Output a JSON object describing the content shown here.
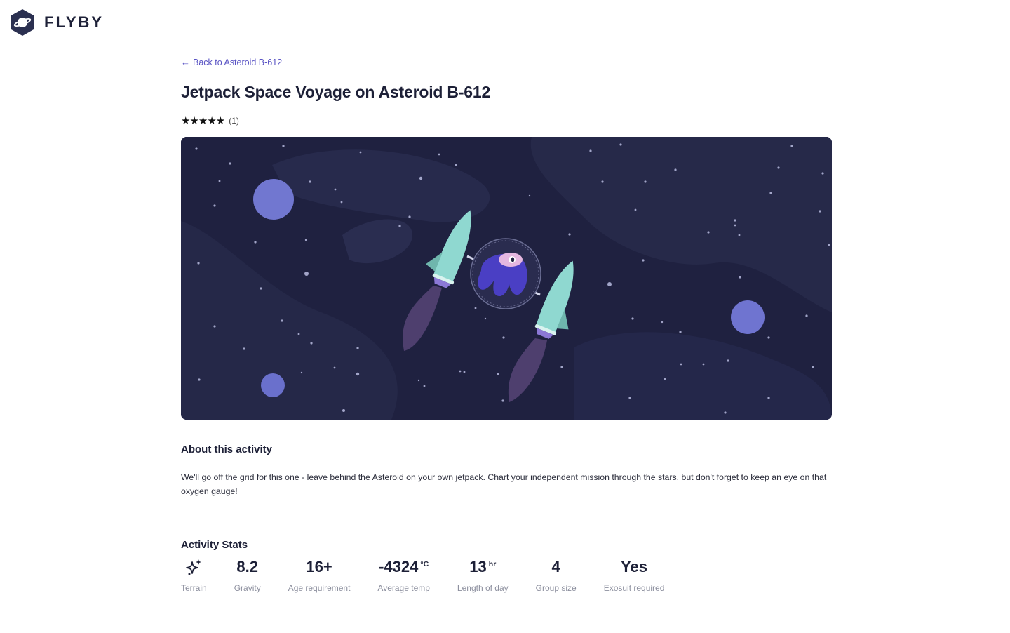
{
  "brand": {
    "name": "FLYBY",
    "logo_icon": "planet-hexagon-icon"
  },
  "nav": {
    "back_label": "Back to Asteroid B-612",
    "back_icon": "arrow-left-icon"
  },
  "activity": {
    "title": "Jetpack Space Voyage on Asteroid B-612",
    "rating": {
      "stars": 5,
      "max": 5,
      "display": "★★★★★",
      "count_label": "(1)"
    }
  },
  "about": {
    "heading": "About this activity",
    "text": "We'll go off the grid for this one - leave behind the Asteroid on your own jetpack. Chart your independent mission through the stars, but don't forget to keep an eye on that oxygen gauge!"
  },
  "stats": {
    "heading": "Activity Stats",
    "terrain": {
      "label": "Terrain",
      "icon": "sparkle-icon"
    },
    "gravity": {
      "value": "8.2",
      "label": "Gravity"
    },
    "age": {
      "value": "16+",
      "label": "Age requirement"
    },
    "temp": {
      "value": "-4324",
      "unit": "°C",
      "label": "Average temp"
    },
    "day": {
      "value": "13",
      "unit": "hr",
      "label": "Length of day"
    },
    "group": {
      "value": "4",
      "label": "Group size"
    },
    "exosuit": {
      "value": "Yes",
      "label": "Exosuit required"
    }
  },
  "colors": {
    "accent": "#5a54c4",
    "hero_bg": "#1f2140",
    "planet": "#6f74d0",
    "jetpack": "#8fd8d0",
    "text": "#1d2037",
    "muted": "#8c8f9e"
  }
}
